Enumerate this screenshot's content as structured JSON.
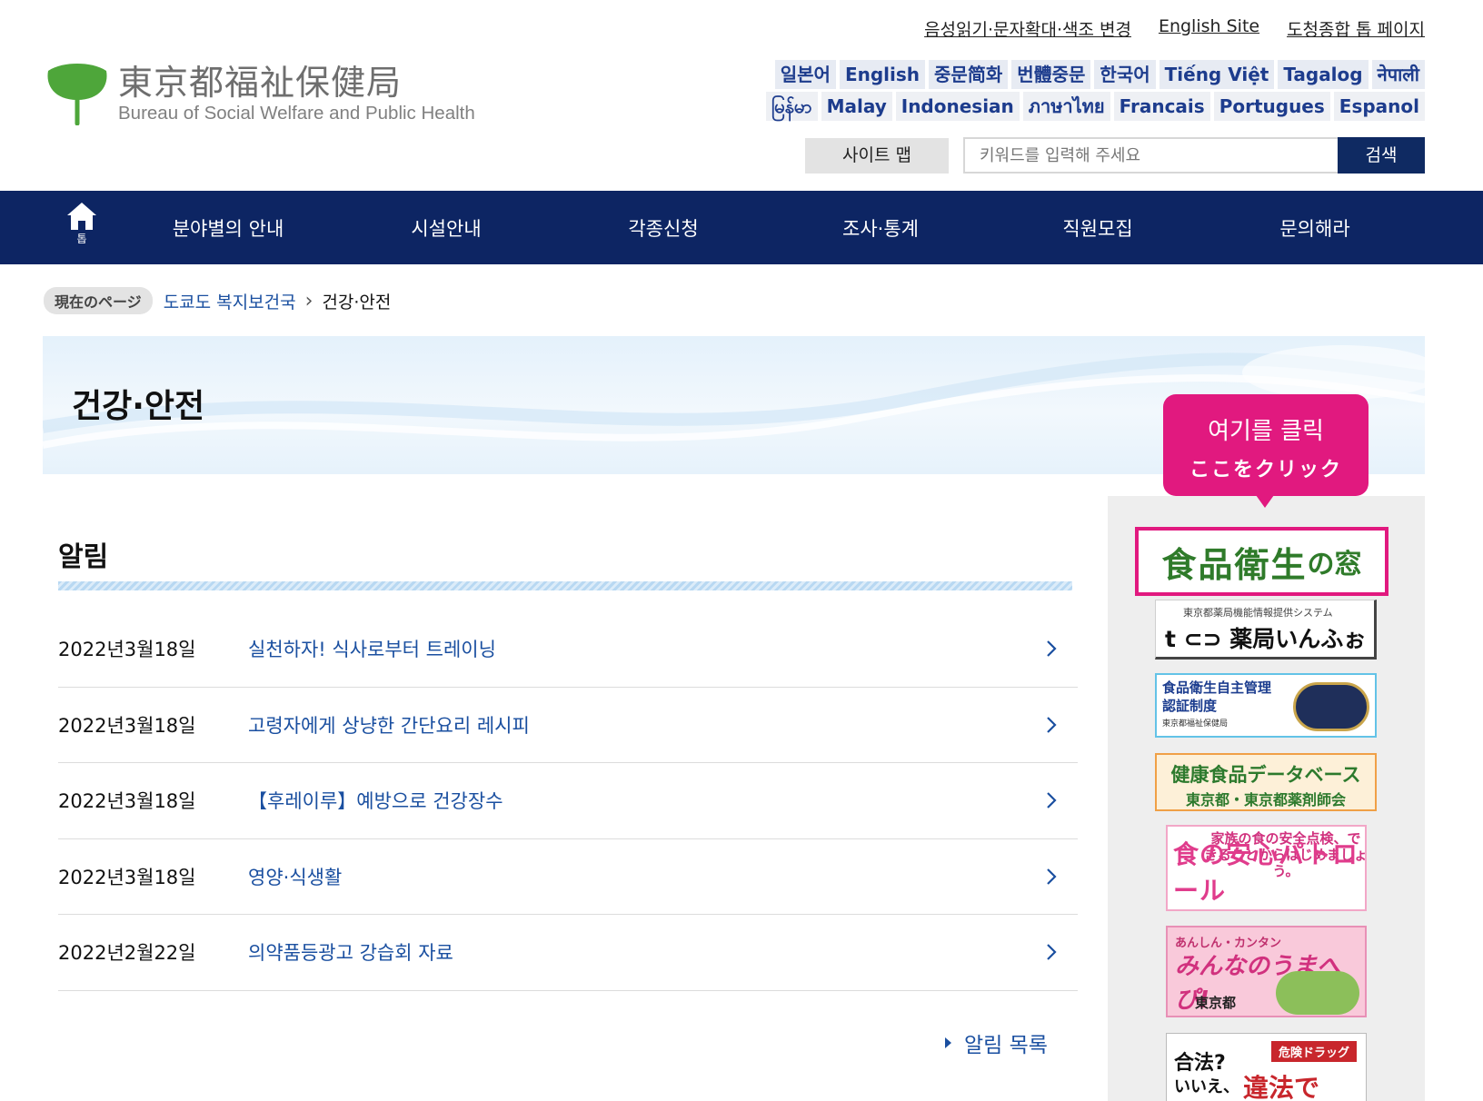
{
  "util_links": [
    "음성읽기·문자확대·색조 변경",
    "English Site",
    "도청종합 톱 페이지"
  ],
  "logo": {
    "jp": "東京都福祉保健局",
    "en": "Bureau of Social Welfare and Public Health"
  },
  "languages": {
    "row1": [
      "일본어",
      "English",
      "중문简화",
      "번體중문",
      "한국어",
      "Tiếng Việt",
      "Tagalog",
      "नेपाली"
    ],
    "row2": [
      "မြန်မာ",
      "Malay",
      "Indonesian",
      "ภาษาไทย",
      "Francais",
      "Portugues",
      "Espanol"
    ]
  },
  "search": {
    "sitemap": "사이트 맵",
    "placeholder": "키워드를 입력해 주세요",
    "button": "검색"
  },
  "nav": {
    "home": "톱",
    "items": [
      "분야별의 안내",
      "시설안내",
      "각종신청",
      "조사·통계",
      "직원모집",
      "문의해라"
    ]
  },
  "breadcrumb": {
    "badge": "現在のページ",
    "parent": "도쿄도 복지보건국",
    "current": "건강·안전"
  },
  "hero_title": "건강·안전",
  "callout": {
    "line1": "여기를 클릭",
    "line2": "ここをクリック"
  },
  "news": {
    "title": "알림",
    "items": [
      {
        "date": "2022년3월18일",
        "title": "실천하자! 식사로부터 트레이닝"
      },
      {
        "date": "2022년3월18일",
        "title": "고령자에게 상냥한 간단요리 레시피"
      },
      {
        "date": "2022년3월18일",
        "title": "【후레이루】예방으로 건강장수"
      },
      {
        "date": "2022년3월18일",
        "title": "영양·식생활"
      },
      {
        "date": "2022년2월22일",
        "title": "의약품등광고 강습회 자료"
      }
    ],
    "more": "알림 목록"
  },
  "banners": {
    "food_window": {
      "main": "食品衛生",
      "suffix": "の窓"
    },
    "pharmacy": {
      "top": "東京都薬局機能情報提供システム",
      "main": "t ⊂⊃ 薬局いんふぉ"
    },
    "certification": {
      "line1": "食品衛生自主管理",
      "line2": "認証制度",
      "org": "東京都福祉保健局"
    },
    "health_db": {
      "line1": "健康食品データベース",
      "line2": "東京都・東京都薬剤師会"
    },
    "patrol": {
      "text": "家族の食の安全点検、できることからはじめましょう。",
      "main": "食の安心パトロール"
    },
    "minna": {
      "small": "あんしん・カンタン",
      "main": "みんなのうまへぴ!",
      "org": "東京都"
    },
    "drug": {
      "q": "合法?",
      "tag": "危険ドラッグ",
      "a": "いいえ、",
      "red": "違法です!!"
    }
  },
  "colors": {
    "nav_bg": "#0d2563",
    "accent_pink": "#e1197f",
    "link_blue": "#1a4fa0",
    "logo_green": "#4ea63a"
  }
}
